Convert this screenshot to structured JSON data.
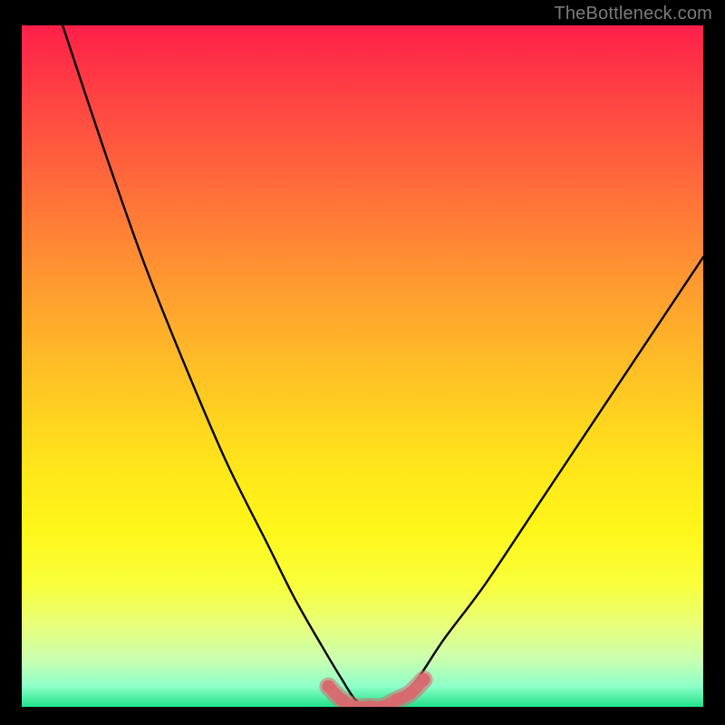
{
  "watermark": "TheBottleneck.com",
  "colors": {
    "background": "#000000",
    "gradient_top": "#ff1f4a",
    "gradient_bottom": "#20e28a",
    "curve_stroke": "#000000",
    "bottom_marker": "#d76a6f"
  },
  "chart_data": {
    "type": "line",
    "title": "",
    "xlabel": "",
    "ylabel": "",
    "xlim": [
      0,
      100
    ],
    "ylim": [
      0,
      100
    ],
    "grid": false,
    "legend": false,
    "annotations": [],
    "series": [
      {
        "name": "bottleneck-curve",
        "x": [
          6,
          12,
          18,
          24,
          30,
          36,
          40,
          44,
          47,
          49,
          51,
          53,
          55,
          58,
          62,
          68,
          76,
          84,
          92,
          100
        ],
        "y": [
          100,
          82,
          65,
          50,
          36,
          24,
          16,
          9,
          4,
          1,
          0,
          0,
          1,
          4,
          10,
          18,
          30,
          42,
          54,
          66
        ]
      },
      {
        "name": "valley-highlight",
        "x": [
          45,
          47,
          49,
          51,
          53,
          55,
          57,
          59
        ],
        "y": [
          3,
          1,
          0,
          0,
          0,
          1,
          2,
          4
        ]
      }
    ]
  }
}
